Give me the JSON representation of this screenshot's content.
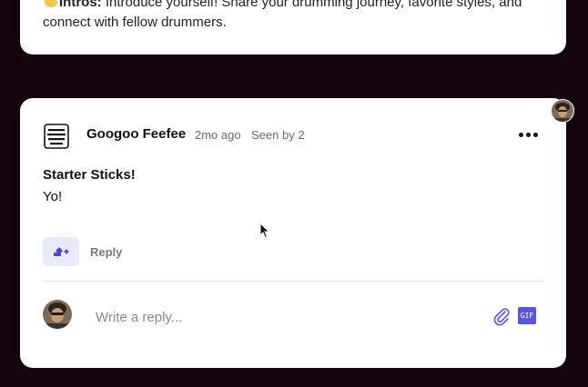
{
  "intro": {
    "label": "Intros:",
    "text": " Introduce yourself! Share your drumming journey, favorite styles, and connect with fellow drummers."
  },
  "post": {
    "author": "Googoo Feefee",
    "time": "2mo ago",
    "seen": "Seen by 2",
    "avatar_icon": "give-it-a-rock-tribe-logo",
    "title": "Starter Sticks!",
    "body": "Yo!",
    "more_icon": "more-dots-icon"
  },
  "actions": {
    "react_icon": "add-reaction-icon",
    "reply_label": "Reply"
  },
  "reply_box": {
    "placeholder": "Write a reply...",
    "attach_icon": "paperclip-icon",
    "gif_label": "GIF"
  },
  "colors": {
    "background": "#13040d",
    "card": "#ffffff",
    "accent": "#5b56d8",
    "react_bg": "#e8e9fb"
  }
}
